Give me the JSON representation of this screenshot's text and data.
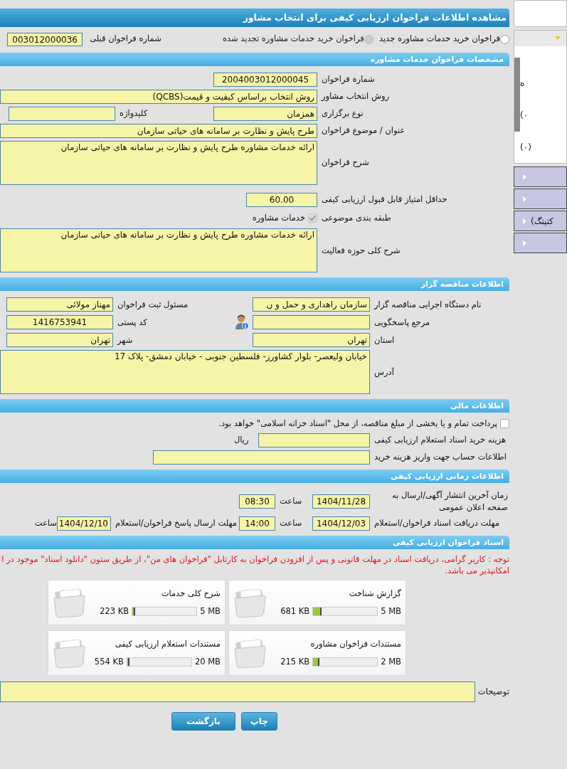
{
  "page_title": "مشاهده اطلاعات فراخوان ارزیابی کیفی برای انتخاب مشاور",
  "call_type": [
    {
      "label": "فراخوان خرید خدمات مشاوره جدید",
      "selected": false,
      "disabled": false
    },
    {
      "label": "فراخوان خرید خدمات مشاوره تجدید شده",
      "selected": false,
      "disabled": true
    }
  ],
  "previous_call_number": {
    "label": "شماره فراخوان قبلی",
    "value": "003012000036"
  },
  "sections": [
    {
      "title": "مشخصات فراخوان خدمات مشاوره",
      "rows": [
        {
          "label": "شماره فراخوان",
          "fields": [
            {
              "kind": "number",
              "value": "2004003012000045"
            }
          ]
        },
        {
          "label": "روش انتخاب مشاور",
          "fields": [
            {
              "kind": "wide",
              "value": "روش انتخاب براساس کیفیت و قیمت(QCBS)"
            }
          ]
        },
        {
          "label": "نوع برگزاری",
          "fields": [
            {
              "kind": "text",
              "value": "همزمان"
            },
            {
              "kind": "label",
              "text": "کلیدواژه"
            },
            {
              "kind": "text"
            }
          ]
        },
        {
          "label": "عنوان / موضوع فراخوان",
          "fields": [
            {
              "kind": "wide",
              "value": "طرح پایش و نظارت بر سامانه های حیاتی سازمان"
            }
          ]
        },
        {
          "label": "شرح فراخوان",
          "fields": [
            {
              "kind": "area",
              "value": "ارائه خدمات مشاوره طرح پایش و نظارت بر سامانه های حیاتی سازمان"
            }
          ]
        },
        {
          "label": "حداقل امتیاز قابل قبول ارزیابی کیفی",
          "fields": [
            {
              "kind": "number",
              "value": "60.00"
            }
          ]
        },
        {
          "label": "طبقه بندی موضوعی",
          "fields": [
            {
              "kind": "check",
              "text": "خدمات مشاوره",
              "checked": true,
              "disabled": true
            }
          ]
        },
        {
          "label": "شرح کلی حوزه فعالیت",
          "fields": [
            {
              "kind": "area",
              "value": "ارائه خدمات مشاوره طرح پایش و نظارت بر سامانه های حیاتی سازمان"
            }
          ]
        }
      ]
    },
    {
      "title": "اطلاعات مناقصه گزار",
      "rows": [
        {
          "label": "نام دستگاه اجرایی مناقصه گزار",
          "fields": [
            {
              "kind": "text",
              "value": "سازمان راهداری و حمل و ن"
            },
            {
              "kind": "label",
              "text": "مسئول ثبت فراخوان"
            },
            {
              "kind": "text",
              "value": "مهناز مولائی"
            }
          ]
        },
        {
          "label": "مرجع پاسخگویی",
          "fields": [
            {
              "kind": "text"
            },
            {
              "kind": "contact"
            },
            {
              "kind": "label",
              "text": "کد پستی"
            },
            {
              "kind": "number",
              "value": "1416753941"
            }
          ]
        },
        {
          "label": "استان",
          "fields": [
            {
              "kind": "text",
              "value": "تهران"
            },
            {
              "kind": "label",
              "text": "شهر"
            },
            {
              "kind": "text",
              "value": "تهران"
            }
          ]
        },
        {
          "label": "آدرس",
          "fields": [
            {
              "kind": "area",
              "value": "خیابان ولیعصر- بلوار کشاورز- فلسطین جنوبی - خیابان دمشق- پلاک 17"
            }
          ]
        }
      ]
    },
    {
      "title": "اطلاعات مالی",
      "rows": [
        {
          "fields": [
            {
              "kind": "check",
              "text": "پرداخت تمام و یا بخشی از مبلغ مناقصه، از محل \"اسناد خزانه اسلامی\" خواهد بود.",
              "checked": false,
              "disabled": false
            }
          ]
        },
        {
          "label": "هزینه خرید اسناد استعلام ارزیابی کیفی",
          "fields": [
            {
              "kind": "text"
            },
            {
              "kind": "label",
              "text": "ریال"
            }
          ]
        },
        {
          "label": "اطلاعات حساب جهت واریز هزینه خرید",
          "fields": [
            {
              "kind": "text"
            }
          ]
        }
      ]
    },
    {
      "title": "اطلاعات زمانی ارزیابی کیفی",
      "rows": [
        {
          "label": "زمان آخرین انتشار آگهی/ارسال به صفحه اعلان عمومی",
          "fields": [
            {
              "kind": "number",
              "value": "1404/11/28"
            },
            {
              "kind": "label",
              "text": "ساعت"
            },
            {
              "kind": "number",
              "value": "08:30"
            }
          ]
        },
        {
          "label": "مهلت دریافت اسناد فراخوان/استعلام",
          "fields": [
            {
              "kind": "number",
              "value": "1404/12/03"
            },
            {
              "kind": "label",
              "text": "ساعت"
            },
            {
              "kind": "number",
              "value": "14:00"
            },
            {
              "kind": "label",
              "text": "مهلت ارسال پاسخ فراخوان/استعلام"
            },
            {
              "kind": "number",
              "value": "1404/12/10"
            },
            {
              "kind": "label",
              "text": "ساعت"
            }
          ]
        }
      ]
    }
  ],
  "documents": {
    "title": "اسناد فراخوان ارزیابی کیفی",
    "notice": "توجه : کاربر گرامی، دریافت اسناد در مهلت قانونی و پس از افزودن فراخوان به کارتابل \"فراخوان های من\"، از طریق ستون \"دانلود اسناد\" موجود در ا امکانپذیر می باشد.",
    "files": [
      {
        "name": "گزارش شناخت",
        "size": "681 KB",
        "limit": "5 MB",
        "level": 0.13
      },
      {
        "name": "شرح کلی خدمات",
        "size": "223 KB",
        "limit": "5 MB",
        "level": 0.04
      },
      {
        "name": "مستندات فراخوان مشاوره",
        "size": "215 KB",
        "limit": "2 MB",
        "level": 0.1
      },
      {
        "name": "مستندات استعلام ارزیابی کیفی",
        "size": "554 KB",
        "limit": "20 MB",
        "level": 0.03
      }
    ],
    "description_label": "توضیحات"
  },
  "buttons": [
    "چاپ",
    "بازگشت"
  ],
  "sidebar": {
    "panel_expanded": true,
    "panel_lines": [
      "ه",
      "(۰",
      "(۰)"
    ],
    "menu_items": [
      {
        "expanded": false
      },
      {
        "expanded": false
      },
      {
        "label": "کتینگ)",
        "expanded": false
      },
      {
        "expanded": false
      }
    ]
  }
}
